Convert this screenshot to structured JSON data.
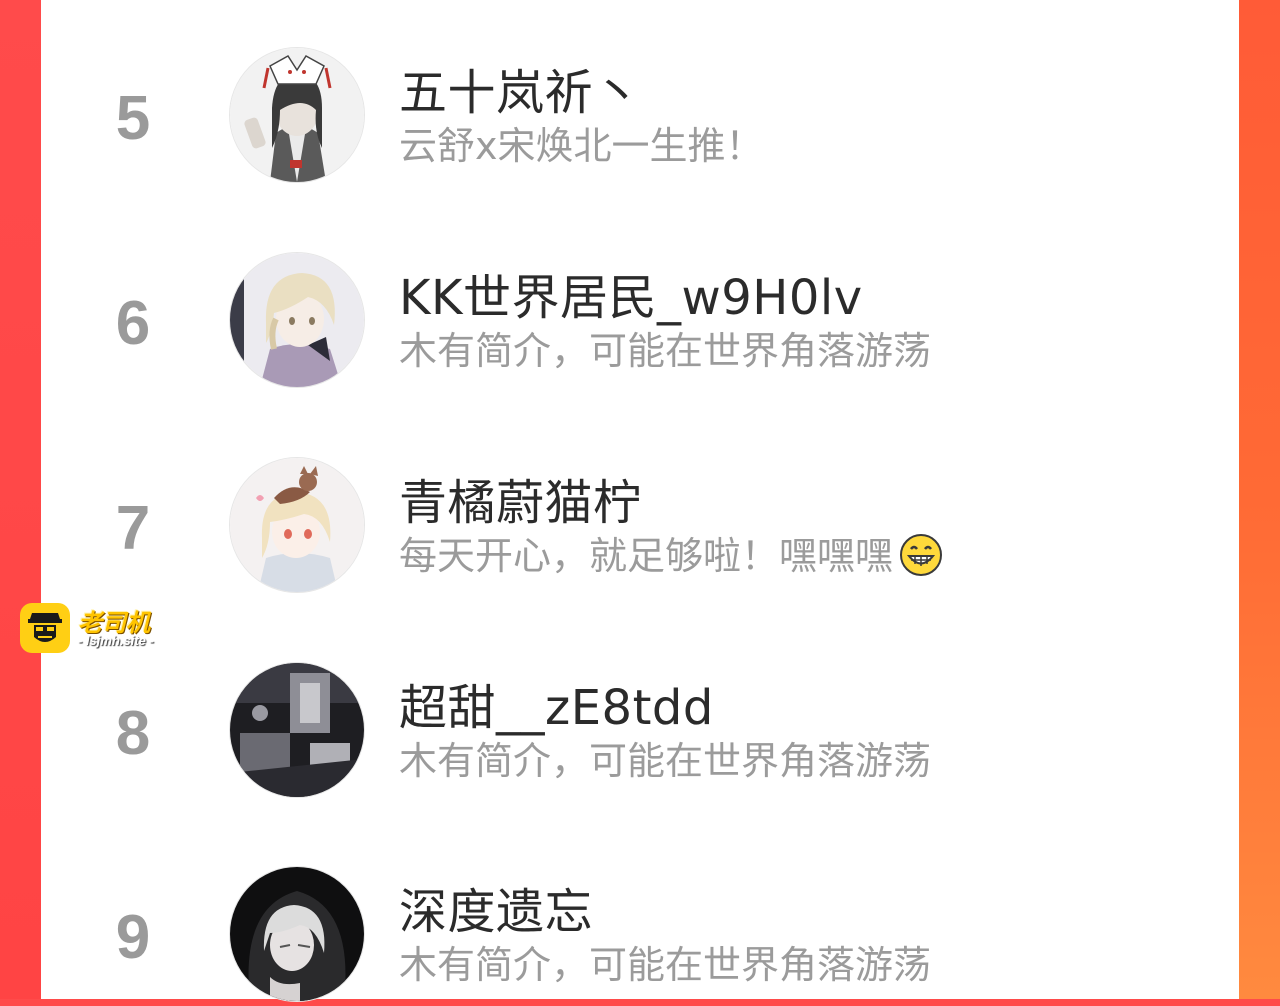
{
  "ranking": [
    {
      "rank": "5",
      "name": "五十岚祈丶",
      "bio": "云舒x宋焕北一生推！",
      "emoji": null
    },
    {
      "rank": "6",
      "name": "KK世界居民_w9H0lv",
      "bio": "木有简介，可能在世界角落游荡",
      "emoji": null
    },
    {
      "rank": "7",
      "name": "青橘蔚猫柠",
      "bio": "每天开心，就足够啦！嘿嘿嘿",
      "emoji": "grinning-face-icon"
    },
    {
      "rank": "8",
      "name": "超甜__zE8tdd",
      "bio": "木有简介，可能在世界角落游荡",
      "emoji": null
    },
    {
      "rank": "9",
      "name": "深度遗忘",
      "bio": "木有简介，可能在世界角落游荡",
      "emoji": null
    }
  ],
  "watermark": {
    "title": "老司机",
    "subtitle": "- lsjmh.site -"
  },
  "colors": {
    "accent": "#ff4a4a",
    "panel": "#ffffff",
    "rank": "#9a9a9a",
    "name": "#2b2b2b",
    "bio": "#9b9b9b"
  }
}
